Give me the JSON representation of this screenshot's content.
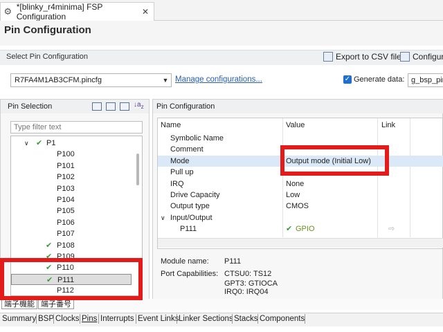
{
  "editor_tab": {
    "title": "*[blinky_r4minima] FSP Configuration",
    "close": "✕"
  },
  "page_title": "Pin Configuration",
  "select_section": {
    "title": "Select Pin Configuration",
    "export_label": "Export to CSV file",
    "configure_label": "Configure",
    "config_value": "R7FA4M1AB3CFM.pincfg",
    "manage_link": "Manage configurations...",
    "generate_label": "Generate data:",
    "generate_checked": true,
    "generate_value": "g_bsp_pin"
  },
  "pin_selection": {
    "title": "Pin Selection",
    "filter_placeholder": "Type filter text",
    "tree": [
      {
        "label": "P1",
        "expanded": true,
        "checked": true,
        "level": 0
      },
      {
        "label": "P100",
        "checked": false,
        "level": 1
      },
      {
        "label": "P101",
        "checked": false,
        "level": 1
      },
      {
        "label": "P102",
        "checked": false,
        "level": 1
      },
      {
        "label": "P103",
        "checked": false,
        "level": 1
      },
      {
        "label": "P104",
        "checked": false,
        "level": 1
      },
      {
        "label": "P105",
        "checked": false,
        "level": 1
      },
      {
        "label": "P106",
        "checked": false,
        "level": 1
      },
      {
        "label": "P107",
        "checked": false,
        "level": 1
      },
      {
        "label": "P108",
        "checked": true,
        "level": 1
      },
      {
        "label": "P109",
        "checked": true,
        "level": 1
      },
      {
        "label": "P110",
        "checked": true,
        "level": 1
      },
      {
        "label": "P111",
        "checked": true,
        "level": 1,
        "selected": true
      },
      {
        "label": "P112",
        "checked": false,
        "level": 1
      }
    ]
  },
  "pin_config": {
    "title": "Pin Configuration",
    "columns": [
      "Name",
      "Value",
      "Link"
    ],
    "rows": [
      {
        "name": "Symbolic Name",
        "value": "",
        "indent": 1
      },
      {
        "name": "Comment",
        "value": "",
        "indent": 1
      },
      {
        "name": "Mode",
        "value": "Output mode (Initial Low)",
        "indent": 1,
        "selected": true
      },
      {
        "name": "Pull up",
        "value": "",
        "indent": 1
      },
      {
        "name": "IRQ",
        "value": "None",
        "indent": 1
      },
      {
        "name": "Drive Capacity",
        "value": "Low",
        "indent": 1
      },
      {
        "name": "Output type",
        "value": "CMOS",
        "indent": 1
      },
      {
        "name": "Input/Output",
        "value": "",
        "indent": 0,
        "expander": "∨"
      },
      {
        "name": "P111",
        "value": "GPIO",
        "indent": 2,
        "value_checked": true,
        "link": true
      }
    ],
    "module_name_label": "Module name:",
    "module_name_value": "P111",
    "port_cap_label": "Port Capabilities:",
    "port_capabilities": [
      "CTSU0: TS12",
      "GPT3: GTIOCA",
      "IRQ0: IRQ04"
    ]
  },
  "sub_tabs": [
    "端子機能",
    "端子番号"
  ],
  "bottom_tabs": [
    "Summary",
    "BSP",
    "Clocks",
    "Pins",
    "Interrupts",
    "Event Links",
    "Linker Sections",
    "Stacks",
    "Components"
  ],
  "colors": {
    "highlight": "#e31b1b",
    "check_green": "#3b9a3b",
    "link_blue": "#2a5db0",
    "selection": "#dbe8f7"
  }
}
